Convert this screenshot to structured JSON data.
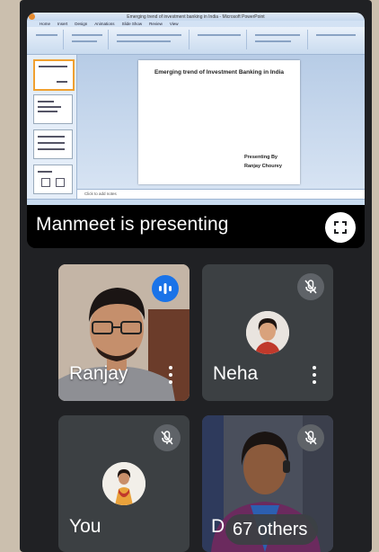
{
  "presentation": {
    "window_title": "Emerging trend of investment banking in India - Microsoft PowerPoint",
    "slide_title": "Emerging trend of Investment Banking in India",
    "presenting_by_label": "Presenting By",
    "presenter_name_on_slide": "Ranjay Chourey",
    "notes_placeholder": "Click to add notes",
    "menu_tabs": [
      "Home",
      "Insert",
      "Design",
      "Animations",
      "Slide Show",
      "Review",
      "View"
    ],
    "presenting_text": "Manmeet is presenting"
  },
  "participants": [
    {
      "name": "Ranjay",
      "status": "speaking",
      "indicator_icon": "audio-level-icon"
    },
    {
      "name": "Neha",
      "status": "muted",
      "indicator_icon": "mic-off-icon"
    },
    {
      "name": "You",
      "status": "muted",
      "indicator_icon": "mic-off-icon"
    },
    {
      "name": "D",
      "status": "muted",
      "indicator_icon": "mic-off-icon"
    }
  ],
  "others_count_label": "67 others",
  "colors": {
    "background": "#202124",
    "tile": "#3c4043",
    "speaking_accent": "#1a73e8",
    "muted_badge": "#5f6368"
  }
}
